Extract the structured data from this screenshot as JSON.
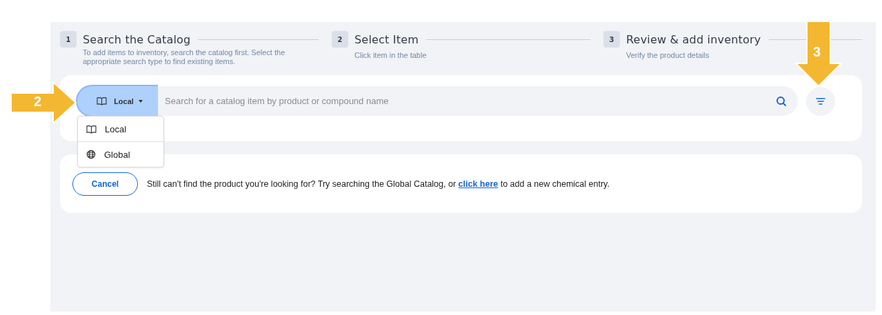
{
  "steps": [
    {
      "number": "1",
      "title": "Search the Catalog",
      "description": "To add items to inventory, search the catalog first. Select the appropriate search type to find existing items."
    },
    {
      "number": "2",
      "title": "Select Item",
      "description": "Click item in the table"
    },
    {
      "number": "3",
      "title": "Review & add inventory",
      "description": "Verify the product details"
    }
  ],
  "search": {
    "scope": {
      "label": "Local",
      "kind": "book",
      "expanded": true
    },
    "placeholder": "Search for a catalog item by product or compound name",
    "scope_menu": [
      {
        "label": "Local",
        "kind": "book"
      },
      {
        "label": "Global",
        "kind": "globe"
      }
    ]
  },
  "footer": {
    "cancel_button": "Cancel",
    "message_before": "Still can't find the product you're looking for? Try searching the Global Catalog, or ",
    "link": "click here",
    "message_after": " to add a new chemical entry."
  },
  "annotations": [
    {
      "label": "2",
      "kind": "right"
    },
    {
      "label": "3",
      "kind": "down"
    }
  ]
}
